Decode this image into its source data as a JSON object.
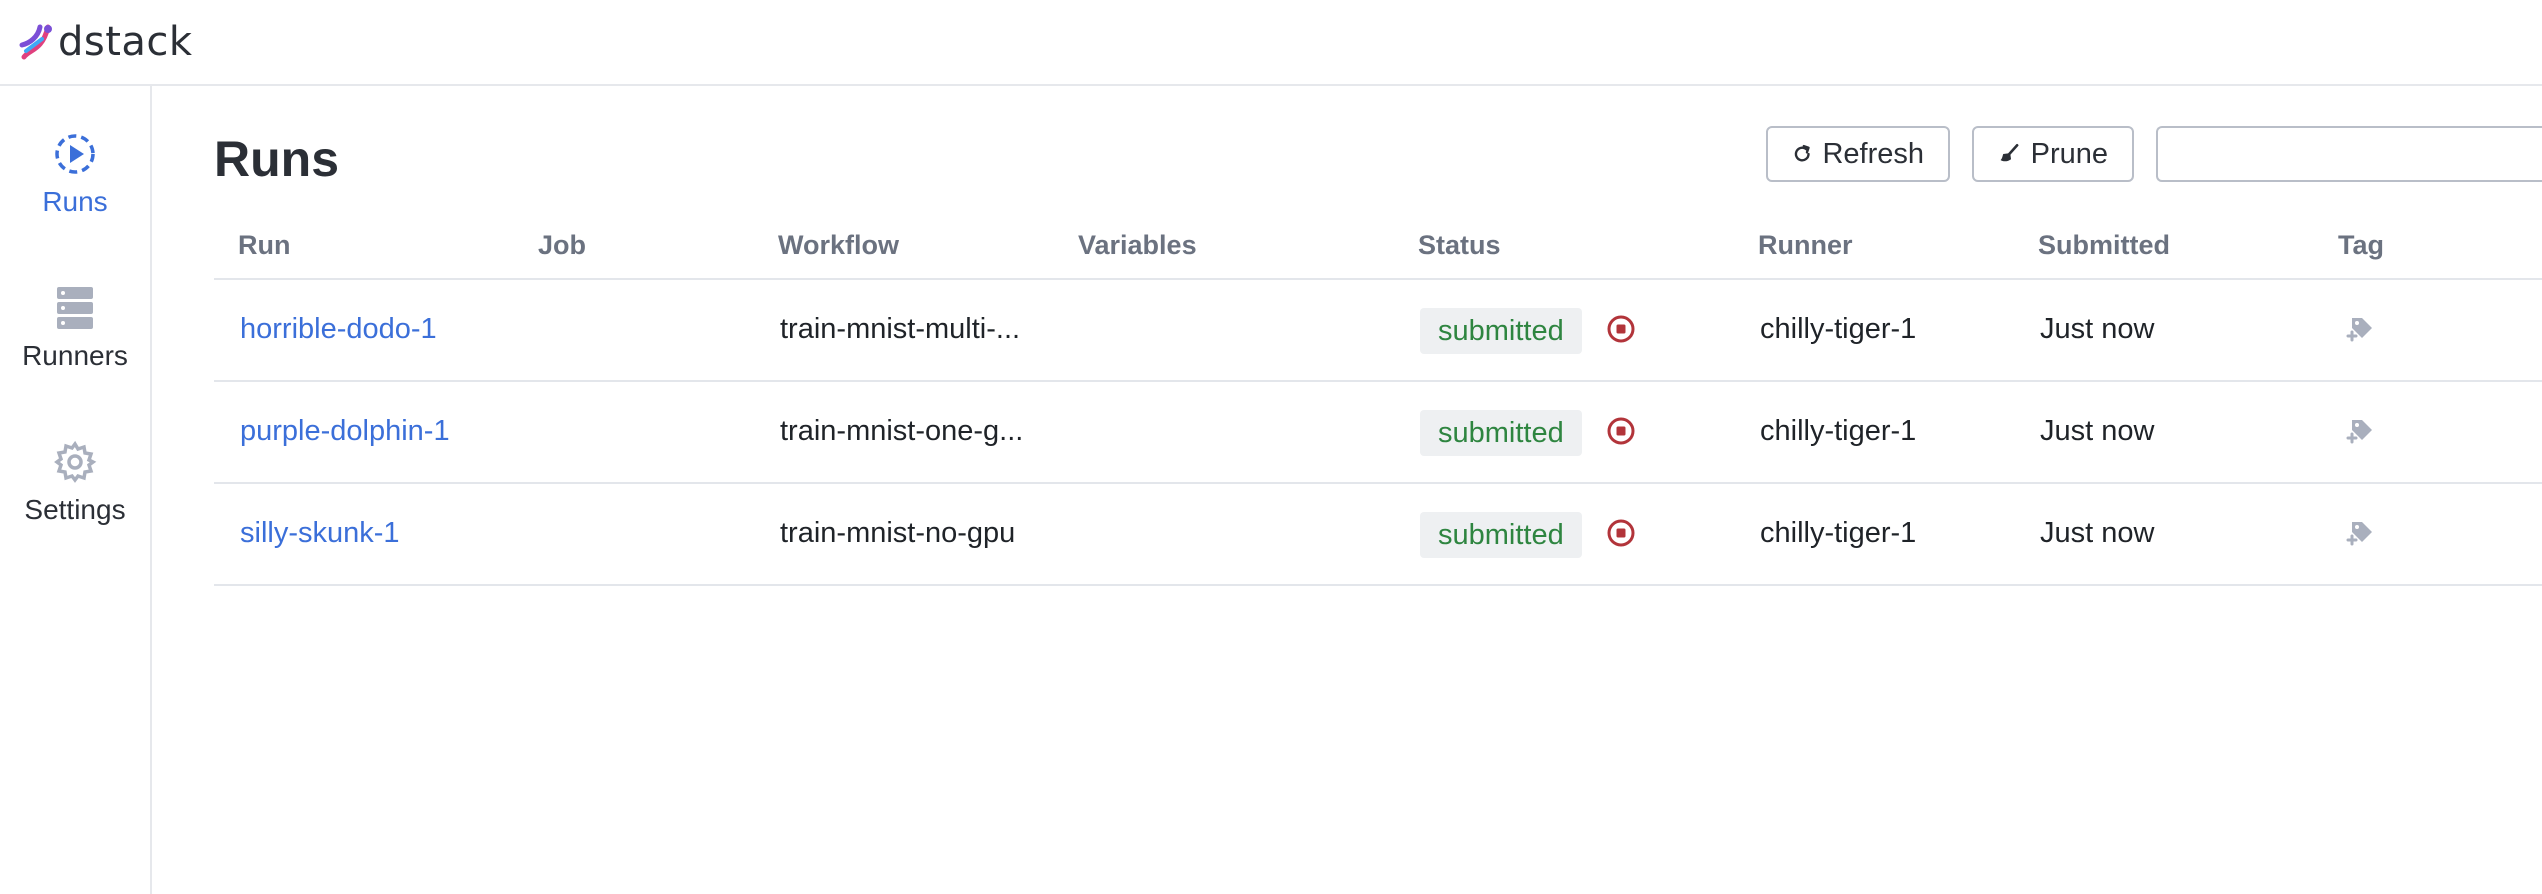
{
  "app": {
    "brand": "dstack"
  },
  "sidebar": {
    "items": [
      {
        "label": "Runs",
        "icon": "play-circle-icon",
        "active": true
      },
      {
        "label": "Runners",
        "icon": "server-icon",
        "active": false
      },
      {
        "label": "Settings",
        "icon": "gear-icon",
        "active": false
      }
    ]
  },
  "page": {
    "title": "Runs"
  },
  "toolbar": {
    "refresh_label": "Refresh",
    "prune_label": "Prune",
    "search_value": "",
    "search_placeholder": ""
  },
  "table": {
    "columns": [
      "Run",
      "Job",
      "Workflow",
      "Variables",
      "Status",
      "Runner",
      "Submitted",
      "Tag"
    ],
    "rows": [
      {
        "run": "horrible-dodo-1",
        "job": "",
        "workflow": "train-mnist-multi-...",
        "variables": "",
        "status": "submitted",
        "runner": "chilly-tiger-1",
        "submitted": "Just now"
      },
      {
        "run": "purple-dolphin-1",
        "job": "",
        "workflow": "train-mnist-one-g...",
        "variables": "",
        "status": "submitted",
        "runner": "chilly-tiger-1",
        "submitted": "Just now"
      },
      {
        "run": "silly-skunk-1",
        "job": "",
        "workflow": "train-mnist-no-gpu",
        "variables": "",
        "status": "submitted",
        "runner": "chilly-tiger-1",
        "submitted": "Just now"
      }
    ]
  },
  "colors": {
    "accent": "#3b6fd9",
    "status_submitted": "#2e8540",
    "stop": "#b2343a",
    "muted_icon": "#a9afbd"
  }
}
